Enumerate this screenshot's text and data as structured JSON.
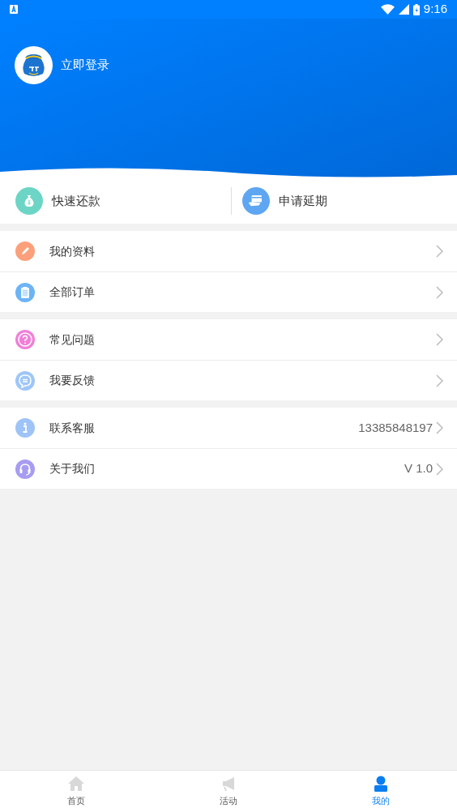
{
  "status_bar": {
    "time": "9:16"
  },
  "header": {
    "login_label": "立即登录"
  },
  "quick_actions": [
    {
      "label": "快速还款",
      "color": "#6dd5c6"
    },
    {
      "label": "申请延期",
      "color": "#5ea6f2"
    }
  ],
  "menu_groups": [
    {
      "items": [
        {
          "label": "我的资料",
          "color": "#fba07a"
        },
        {
          "label": "全部订单",
          "color": "#6cb4f5"
        }
      ]
    },
    {
      "items": [
        {
          "label": "常见问题",
          "color": "#f07fd8"
        },
        {
          "label": "我要反馈",
          "color": "#9ec6f8"
        }
      ]
    },
    {
      "items": [
        {
          "label": "联系客服",
          "value": "13385848197",
          "color": "#9ec4f7"
        },
        {
          "label": "关于我们",
          "value": "V 1.0",
          "color": "#a79cf2"
        }
      ]
    }
  ],
  "tabs": [
    {
      "label": "首页",
      "selected": false
    },
    {
      "label": "活动",
      "selected": false
    },
    {
      "label": "我的",
      "selected": true
    }
  ]
}
